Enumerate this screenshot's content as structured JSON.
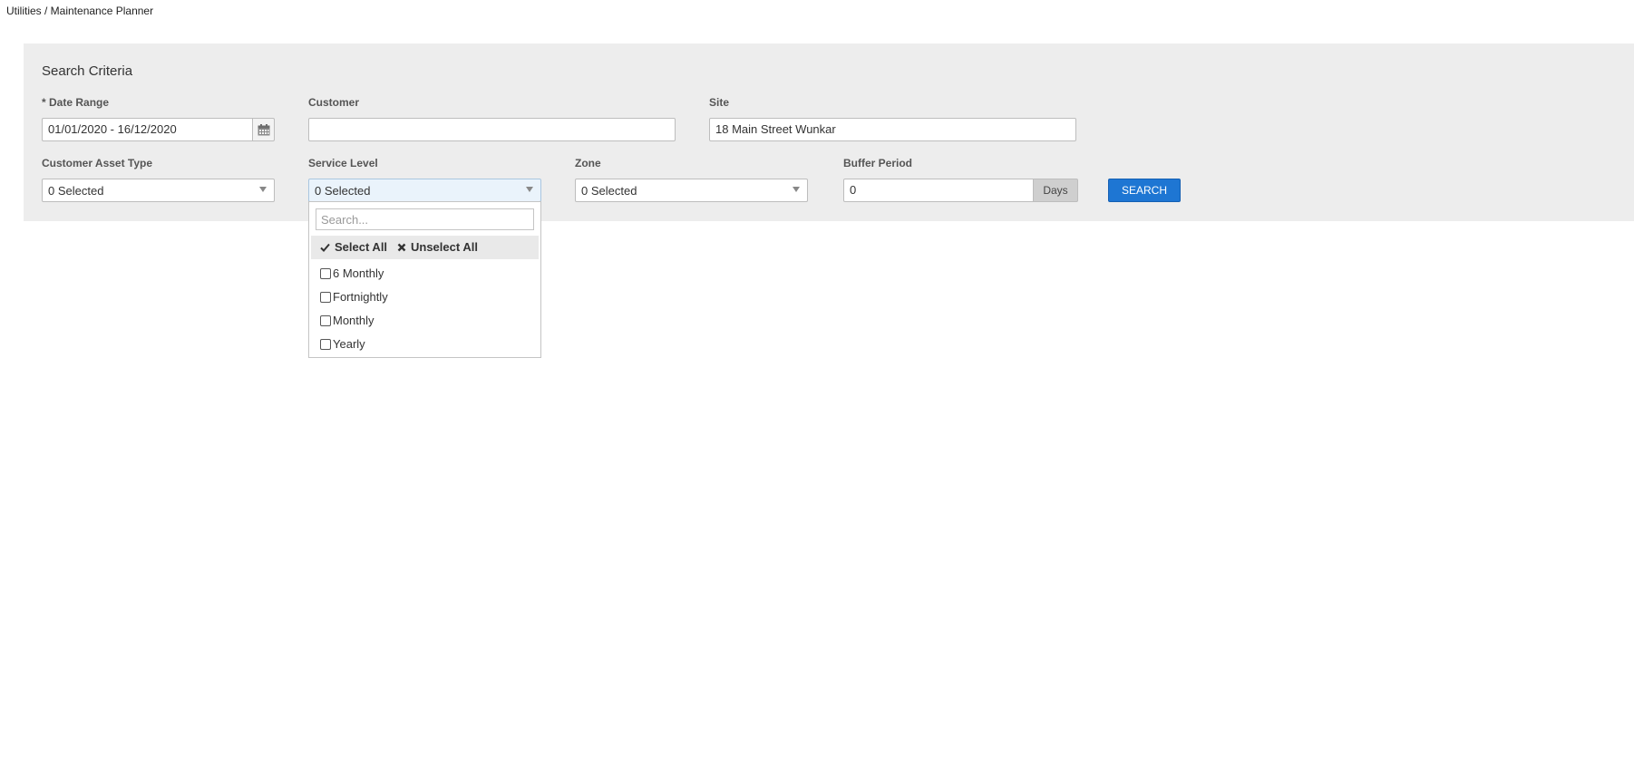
{
  "breadcrumb": "Utilities / Maintenance Planner",
  "panel": {
    "title": "Search Criteria"
  },
  "fields": {
    "date_range": {
      "label": "* Date Range",
      "value": "01/01/2020 - 16/12/2020",
      "icon": "calendar-icon"
    },
    "customer": {
      "label": "Customer",
      "value": ""
    },
    "site": {
      "label": "Site",
      "value": "18 Main Street Wunkar"
    },
    "customer_asset_type": {
      "label": "Customer Asset Type",
      "value": "0 Selected"
    },
    "service_level": {
      "label": "Service Level",
      "value": "0 Selected"
    },
    "zone": {
      "label": "Zone",
      "value": "0 Selected"
    },
    "buffer_period": {
      "label": "Buffer Period",
      "value": "0",
      "addon": "Days"
    }
  },
  "search_button": "SEARCH",
  "service_level_dropdown": {
    "search_placeholder": "Search...",
    "select_all": "Select All",
    "unselect_all": "Unselect All",
    "options": [
      "6 Monthly",
      "Fortnightly",
      "Monthly",
      "Yearly"
    ]
  },
  "colors": {
    "panel_bg": "#ededed",
    "primary_button": "#1e76d3"
  }
}
